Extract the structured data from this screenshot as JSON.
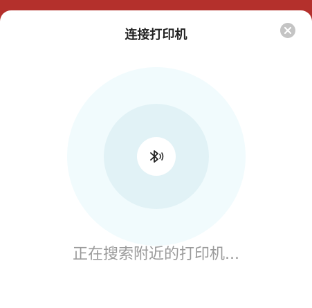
{
  "dialog": {
    "title": "连接打印机",
    "close_icon": "close-icon",
    "status_text": "正在搜索附近的打印机..."
  },
  "scanner": {
    "icon": "bluetooth-searching-icon",
    "colors": {
      "outer": "#f1fbfd",
      "inner": "#e1f2f6",
      "center": "#ffffff"
    }
  },
  "colors": {
    "header_bar": "#b4302c",
    "title": "#222222",
    "status": "#9a9a9a",
    "close_bg": "#c4c4c4"
  }
}
